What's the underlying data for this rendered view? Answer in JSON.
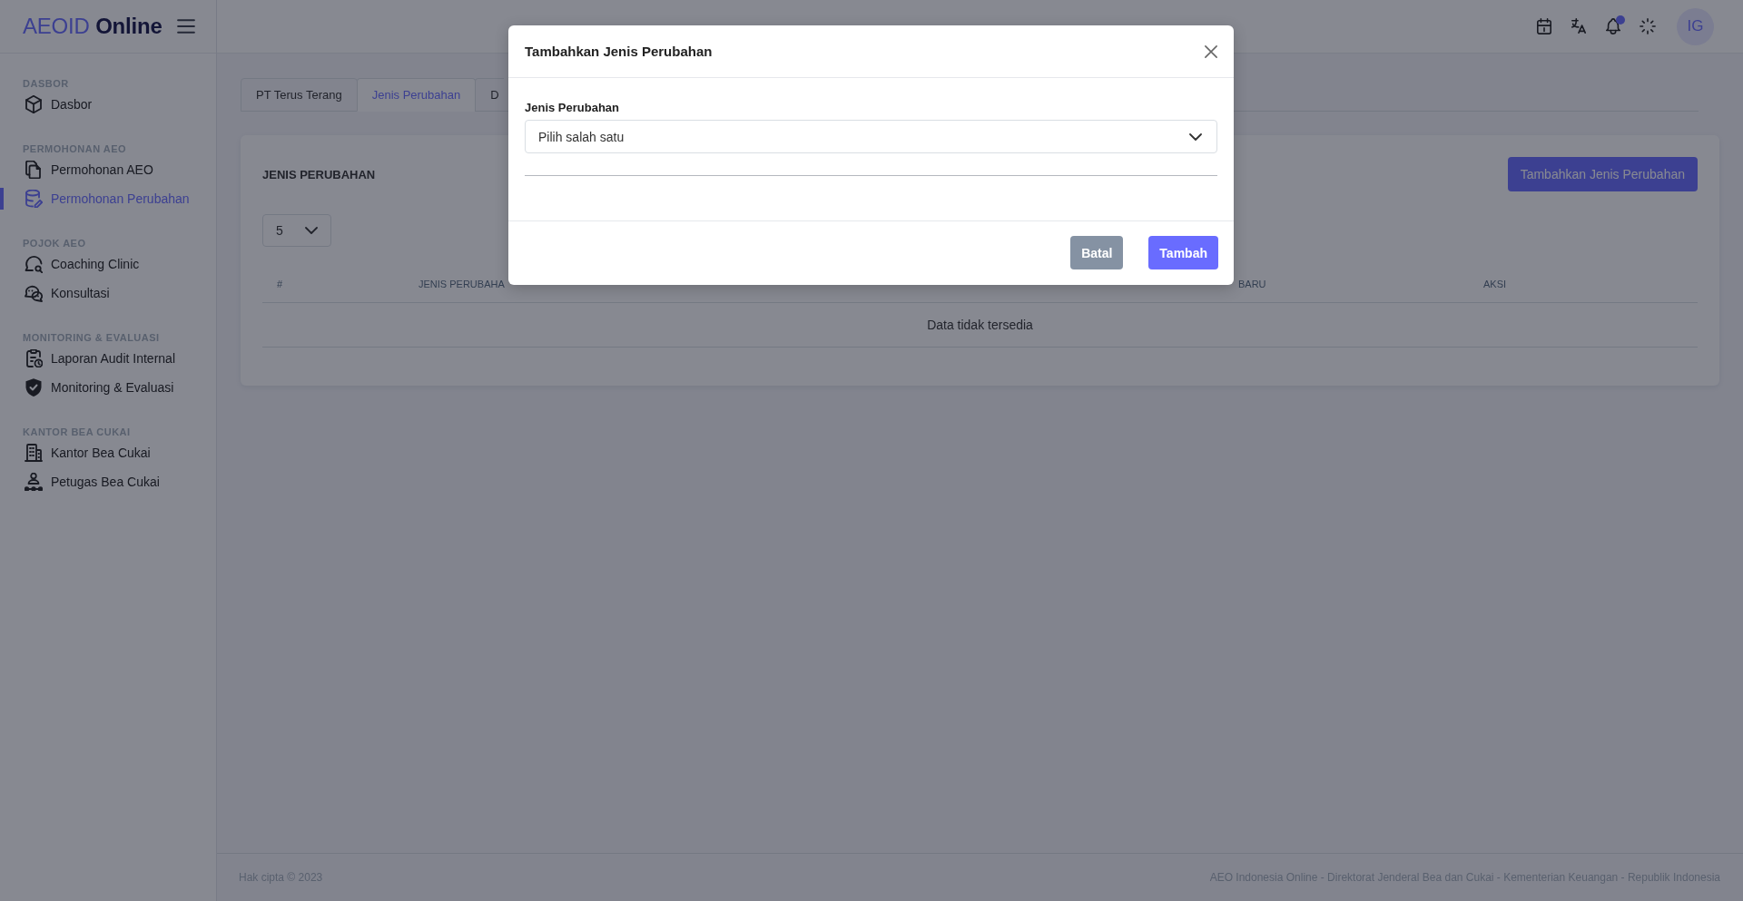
{
  "sidebar": {
    "logo": "AEOID **Online**",
    "sections": [
      {
        "heading": "DASBOR",
        "items": [
          {
            "label": "Dasbor",
            "selected": false
          }
        ]
      },
      {
        "heading": "PERMOHONAN AEO",
        "items": [
          {
            "label": "Permohonan AEO",
            "selected": false
          },
          {
            "label": "Permohonan Perubahan",
            "selected": true
          }
        ]
      },
      {
        "heading": "POJOK AEO",
        "items": [
          {
            "label": "Coaching Clinic",
            "selected": false
          },
          {
            "label": "Konsultasi",
            "selected": false
          }
        ]
      },
      {
        "heading": "MONITORING & EVALUASI",
        "items": [
          {
            "label": "Laporan Audit Internal",
            "selected": false
          },
          {
            "label": "Monitoring & Evaluasi",
            "selected": false
          }
        ]
      },
      {
        "heading": "KANTOR BEA CUKAI",
        "items": [
          {
            "label": "Kantor Bea Cukai",
            "selected": false
          },
          {
            "label": "Petugas Bea Cukai",
            "selected": false
          }
        ]
      }
    ]
  },
  "top_bar": {
    "notifications": {
      "unread": true
    },
    "avatar": {
      "initials": "IG"
    }
  },
  "tabs": [
    {
      "label": "PT Terus Terang",
      "selected": false
    },
    {
      "label": "Jenis Perubahan",
      "selected": true
    },
    {
      "label": "D",
      "selected": false
    }
  ],
  "card": {
    "title": "JENIS PERUBAHAN",
    "add_button": "Tambahkan Jenis Perubahan",
    "page_size": {
      "value": "5"
    },
    "table": {
      "columns": [
        "#",
        "JENIS PERUBAHA",
        "BARU",
        "AKSI"
      ],
      "empty_message": "Data tidak tersedia"
    }
  },
  "modal": {
    "title": "Tambahkan Jenis Perubahan",
    "field": {
      "label": "Jenis Perubahan",
      "value": "Pilih salah satu"
    },
    "buttons": [
      {
        "label": "Batal",
        "kind": "secondary"
      },
      {
        "label": "Tambah",
        "kind": "primary"
      }
    ]
  },
  "footer": {
    "copyright": "Hak cipta © 2023",
    "credits": "AEO Indonesia Online - Direktorat Jenderal Bea dan Cukai - Kementerian Keuangan - Republik Indonesia"
  }
}
